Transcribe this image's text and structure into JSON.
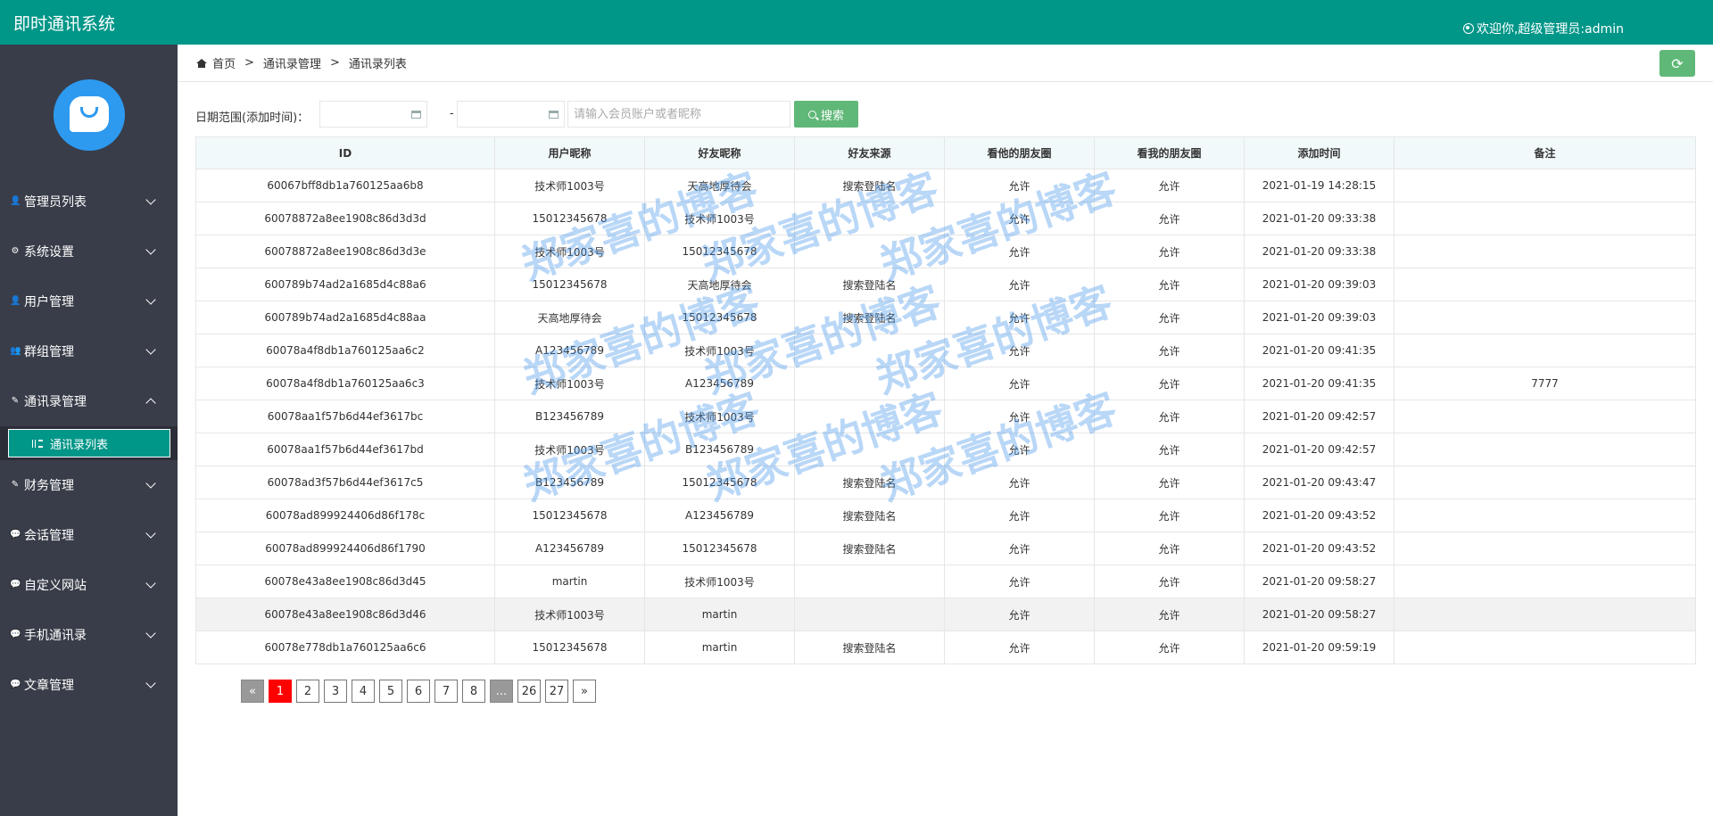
{
  "header": {
    "app_title": "即时通讯系统",
    "welcome": "欢迎你,超级管理员:admin"
  },
  "sidebar": {
    "items": [
      {
        "label": "管理员列表",
        "icon": "user-icon"
      },
      {
        "label": "系统设置",
        "icon": "gear-icon"
      },
      {
        "label": "用户管理",
        "icon": "user-icon"
      },
      {
        "label": "群组管理",
        "icon": "users-icon"
      },
      {
        "label": "通讯录管理",
        "icon": "edit-icon",
        "open": true
      },
      {
        "label": "财务管理",
        "icon": "edit-icon"
      },
      {
        "label": "会话管理",
        "icon": "chat-icon"
      },
      {
        "label": "自定义网站",
        "icon": "chat-icon"
      },
      {
        "label": "手机通讯录",
        "icon": "chat-icon"
      },
      {
        "label": "文章管理",
        "icon": "chat-icon"
      }
    ],
    "active_sub": "通讯录列表"
  },
  "breadcrumb": {
    "home": "首页",
    "level1": "通讯录管理",
    "level2": "通讯录列表",
    "separator": ">"
  },
  "filter": {
    "date_label": "日期范围(添加时间)：",
    "dash": "-",
    "date_start": "",
    "date_end": "",
    "keyword_placeholder": "请输入会员账户或者昵称",
    "search_label": "搜索"
  },
  "table": {
    "headers": [
      "ID",
      "用户昵称",
      "好友昵称",
      "好友来源",
      "看他的朋友圈",
      "看我的朋友圈",
      "添加时间",
      "备注"
    ],
    "rows": [
      [
        "60067bff8db1a760125aa6b8",
        "技术师1003号",
        "天高地厚待会",
        "搜索登陆名",
        "允许",
        "允许",
        "2021-01-19 14:28:15",
        ""
      ],
      [
        "60078872a8ee1908c86d3d3d",
        "15012345678",
        "技术师1003号",
        "",
        "允许",
        "允许",
        "2021-01-20 09:33:38",
        ""
      ],
      [
        "60078872a8ee1908c86d3d3e",
        "技术师1003号",
        "15012345678",
        "",
        "允许",
        "允许",
        "2021-01-20 09:33:38",
        ""
      ],
      [
        "600789b74ad2a1685d4c88a6",
        "15012345678",
        "天高地厚待会",
        "搜索登陆名",
        "允许",
        "允许",
        "2021-01-20 09:39:03",
        ""
      ],
      [
        "600789b74ad2a1685d4c88aa",
        "天高地厚待会",
        "15012345678",
        "搜索登陆名",
        "允许",
        "允许",
        "2021-01-20 09:39:03",
        ""
      ],
      [
        "60078a4f8db1a760125aa6c2",
        "A123456789",
        "技术师1003号",
        "",
        "允许",
        "允许",
        "2021-01-20 09:41:35",
        ""
      ],
      [
        "60078a4f8db1a760125aa6c3",
        "技术师1003号",
        "A123456789",
        "",
        "允许",
        "允许",
        "2021-01-20 09:41:35",
        "7777"
      ],
      [
        "60078aa1f57b6d44ef3617bc",
        "B123456789",
        "技术师1003号",
        "",
        "允许",
        "允许",
        "2021-01-20 09:42:57",
        ""
      ],
      [
        "60078aa1f57b6d44ef3617bd",
        "技术师1003号",
        "B123456789",
        "",
        "允许",
        "允许",
        "2021-01-20 09:42:57",
        ""
      ],
      [
        "60078ad3f57b6d44ef3617c5",
        "B123456789",
        "15012345678",
        "搜索登陆名",
        "允许",
        "允许",
        "2021-01-20 09:43:47",
        ""
      ],
      [
        "60078ad899924406d86f178c",
        "15012345678",
        "A123456789",
        "搜索登陆名",
        "允许",
        "允许",
        "2021-01-20 09:43:52",
        ""
      ],
      [
        "60078ad899924406d86f1790",
        "A123456789",
        "15012345678",
        "搜索登陆名",
        "允许",
        "允许",
        "2021-01-20 09:43:52",
        ""
      ],
      [
        "60078e43a8ee1908c86d3d45",
        "martin",
        "技术师1003号",
        "",
        "允许",
        "允许",
        "2021-01-20 09:58:27",
        ""
      ],
      [
        "60078e43a8ee1908c86d3d46",
        "技术师1003号",
        "martin",
        "",
        "允许",
        "允许",
        "2021-01-20 09:58:27",
        ""
      ],
      [
        "60078e778db1a760125aa6c6",
        "15012345678",
        "martin",
        "搜索登陆名",
        "允许",
        "允许",
        "2021-01-20 09:59:19",
        ""
      ]
    ],
    "highlighted_row": 13
  },
  "pagination": {
    "prev": "«",
    "next": "»",
    "pages": [
      "1",
      "2",
      "3",
      "4",
      "5",
      "6",
      "7",
      "8",
      "...",
      "26",
      "27"
    ],
    "current": "1"
  },
  "watermark": "郑家喜的博客",
  "colors": {
    "primary": "#009688",
    "sidebar": "#393d49",
    "button": "#5fb878",
    "current_page": "#ff0000"
  }
}
